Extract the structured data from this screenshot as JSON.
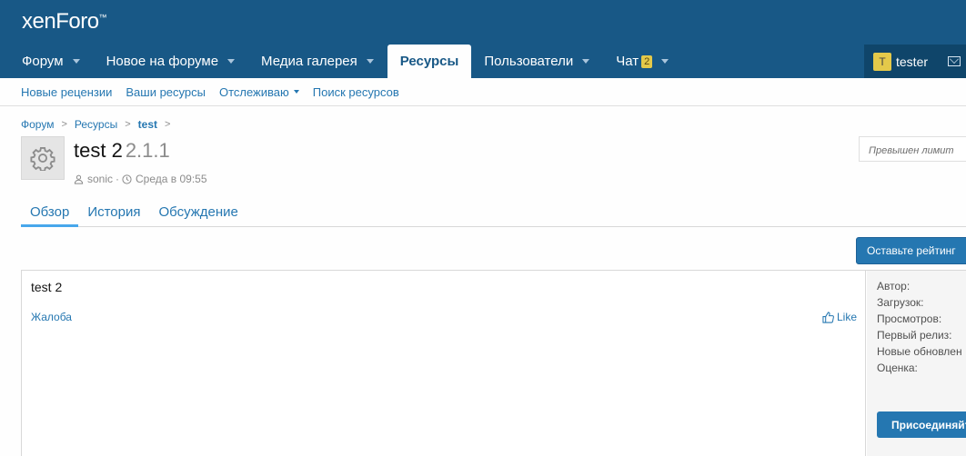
{
  "header": {
    "logo": "xenForo",
    "nav": [
      {
        "label": "Форум",
        "has_caret": true
      },
      {
        "label": "Новое на форуме",
        "has_caret": true
      },
      {
        "label": "Медиа галерея",
        "has_caret": true
      },
      {
        "label": "Ресурсы",
        "active": true
      },
      {
        "label": "Пользователи",
        "has_caret": true
      },
      {
        "label": "Чат",
        "badge": "2",
        "has_caret": true
      }
    ],
    "user": {
      "avatar_letter": "T",
      "name": "tester"
    }
  },
  "subnav": {
    "items": [
      "Новые рецензии",
      "Ваши ресурсы",
      "Отслеживаю",
      "Поиск ресурсов"
    ]
  },
  "breadcrumbs": [
    "Форум",
    "Ресурсы",
    "test"
  ],
  "resource": {
    "title": "test 2",
    "version": "2.1.1",
    "author": "sonic",
    "date": "Среда в 09:55",
    "icon": "gear-icon"
  },
  "notice": "Превышен лимит",
  "tabs": [
    "Обзор",
    "История",
    "Обсуждение"
  ],
  "buttons": {
    "rate": "Оставьте рейтинг",
    "join": "Присоединяйт"
  },
  "content": {
    "description": "test 2",
    "report": "Жалоба",
    "like": "Like"
  },
  "sidebar": {
    "fields": [
      "Автор:",
      "Загрузок:",
      "Просмотров:",
      "Первый релиз:",
      "Новые обновлен",
      "Оценка:"
    ]
  },
  "colors": {
    "header_bg": "#185886",
    "link": "#2577b1",
    "badge": "#e4c94a"
  }
}
